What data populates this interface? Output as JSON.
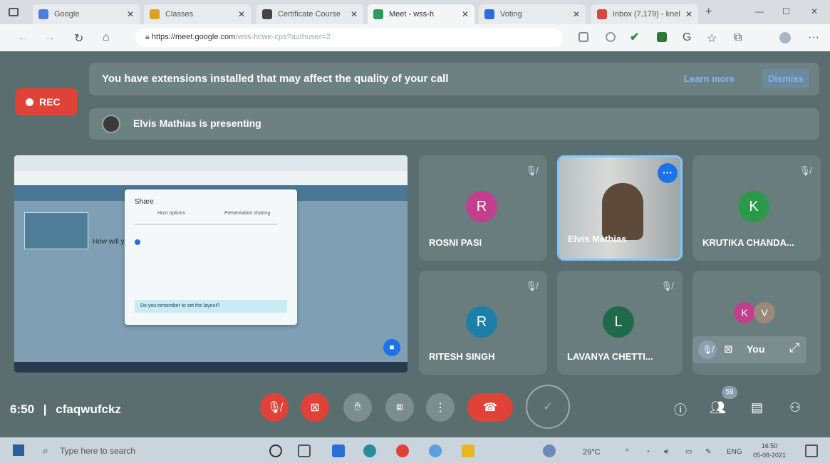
{
  "browser": {
    "tabs": [
      {
        "label": "Google",
        "icon": "google-icon",
        "color": "#4a7fe0"
      },
      {
        "label": "Classes",
        "icon": "classroom-icon",
        "color": "#e0a020"
      },
      {
        "label": "Certificate Course",
        "icon": "classroom-icon",
        "color": "#444"
      },
      {
        "label": "Meet - wss-h",
        "icon": "meet-icon",
        "color": "#2a9d5c"
      },
      {
        "label": "Voting",
        "icon": "chart-icon",
        "color": "#2a6ed6"
      },
      {
        "label": "Inbox (7,179) - knel",
        "icon": "gmail-icon",
        "color": "#d44"
      }
    ],
    "url_host": "https://meet.google.com",
    "url_path": "/wss-hcwe-cps?authuser=2"
  },
  "meet": {
    "banner_text": "You have extensions installed that may affect the quality of your call",
    "learn_more": "Learn more",
    "dismiss": "Dismiss",
    "rec_label": "REC",
    "presenting_text": "Elvis Mathias is presenting",
    "participants": [
      {
        "name": "ROSNI PASI",
        "initial": "R",
        "color": "#c23f8e"
      },
      {
        "name": "Elvis Mathias",
        "initial": "",
        "color": "#3a3a3a"
      },
      {
        "name": "KRUTIKA CHANDA...",
        "initial": "K",
        "color": "#2a9a4a"
      },
      {
        "name": "RITESH SINGH",
        "initial": "R",
        "color": "#1c7fa8"
      },
      {
        "name": "LAVANYA CHETTI...",
        "initial": "L",
        "color": "#1f6a4a"
      }
    ],
    "self_tile": {
      "initial_1": "K",
      "initial_2": "V",
      "label": "You"
    },
    "shared_screen": {
      "dialog_title": "Share",
      "tab_1": "Host options",
      "tab_2": "Presentation sharing",
      "question": "Do you remember to set the layout?",
      "side_text": "How will y... orientation..."
    },
    "time": "6:50",
    "meeting_code": "cfaqwufckz",
    "participant_count": "59"
  },
  "taskbar": {
    "search_placeholder": "Type here to search",
    "weather": "29°C",
    "lang": "ENG",
    "clock_time": "16:50",
    "clock_date": "05-08-2021"
  }
}
